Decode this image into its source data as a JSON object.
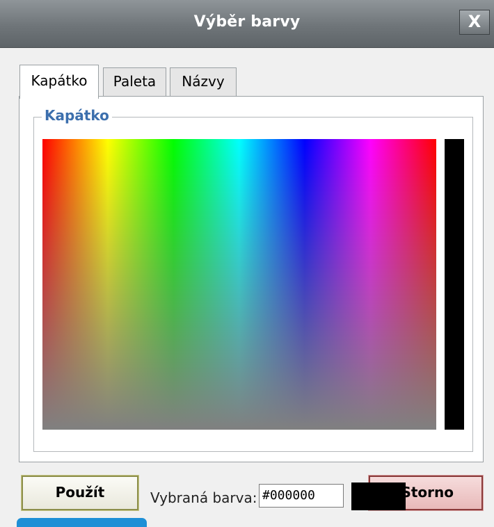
{
  "window": {
    "title": "Výběr barvy",
    "close_label": "X"
  },
  "tabs": [
    {
      "label": "Kapátko",
      "active": true
    },
    {
      "label": "Paleta",
      "active": false
    },
    {
      "label": "Názvy",
      "active": false
    }
  ],
  "eyedropper": {
    "group_label": "Kapátko"
  },
  "footer": {
    "apply_label": "Použít",
    "selected_label": "Vybraná barva:",
    "selected_value": "#000000",
    "cancel_label": "Storno"
  },
  "colors": {
    "selected_swatch": "#000000",
    "accent_label": "#3c6fad"
  }
}
